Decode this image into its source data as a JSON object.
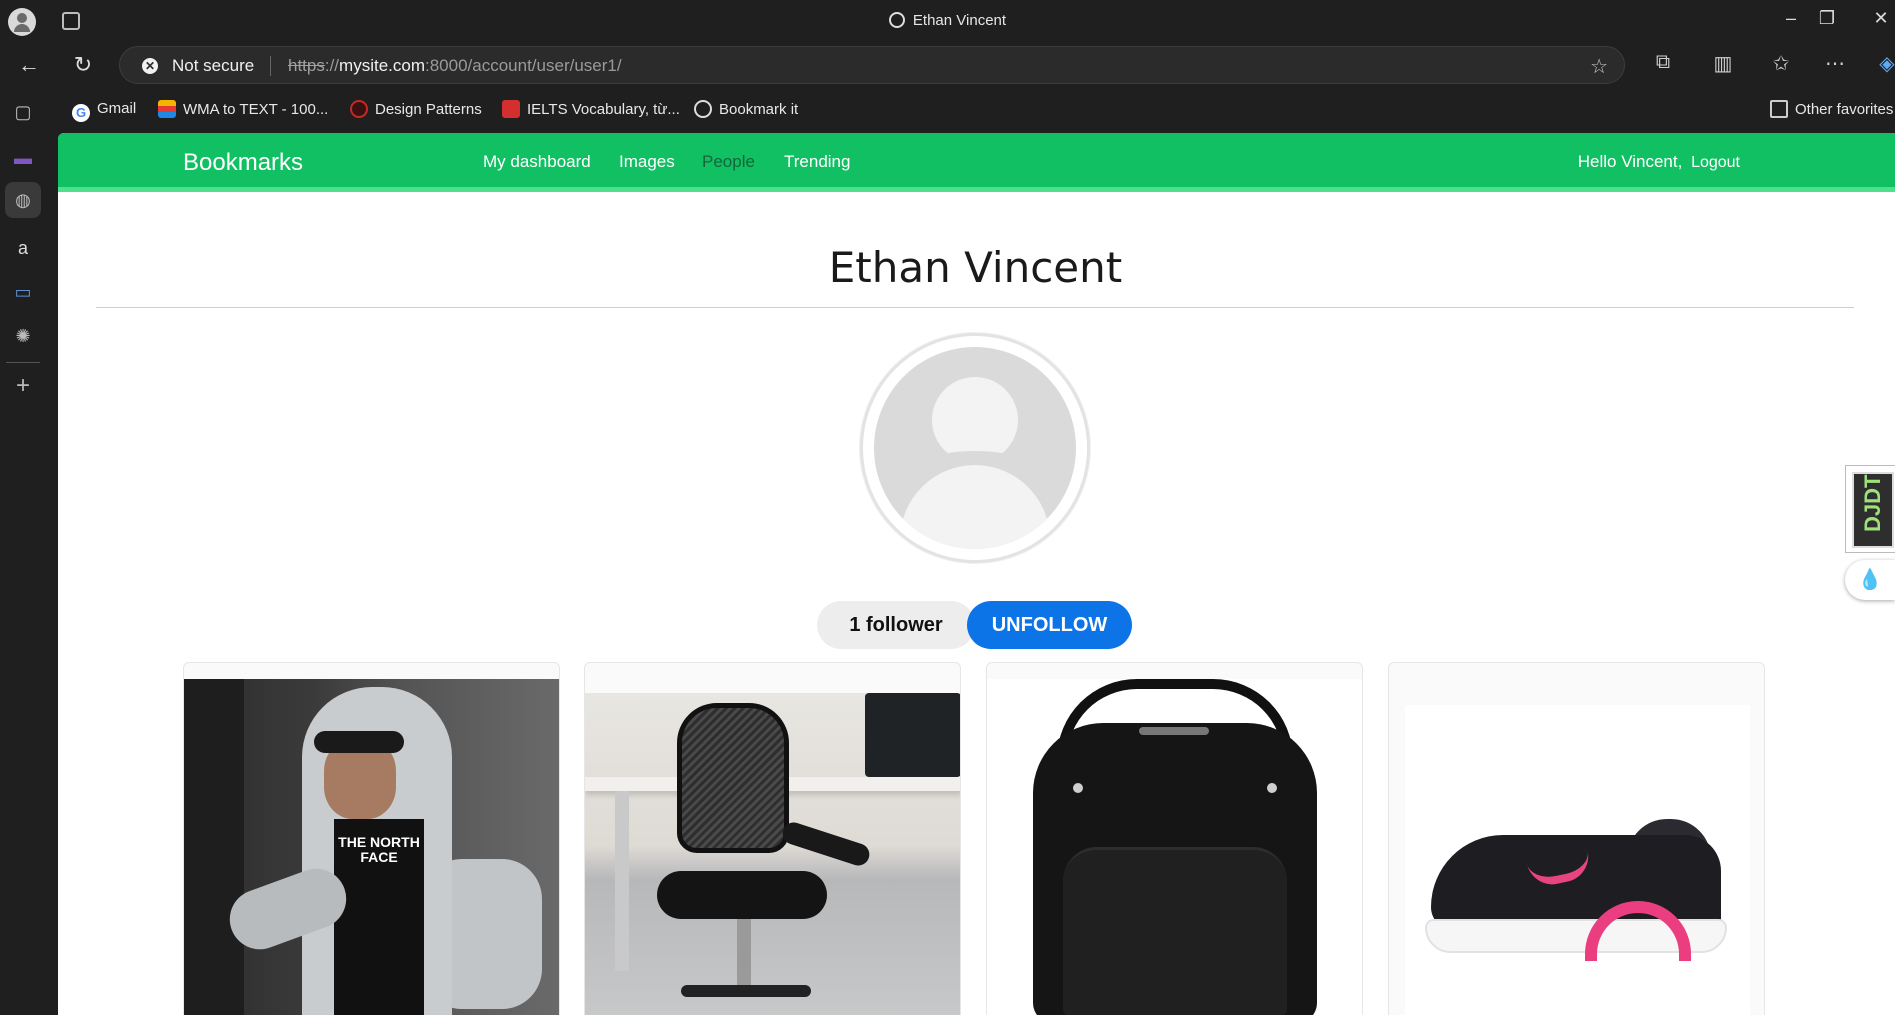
{
  "browser": {
    "window_title": "Ethan Vincent",
    "omnibox": {
      "security_label": "Not secure",
      "url_scheme": "https",
      "url_host": "mysite.com",
      "url_rest": ":8000/account/user/user1/"
    },
    "bookmarks": [
      {
        "label": "Gmail",
        "icon": "google-icon",
        "color": "#4285f4"
      },
      {
        "label": "WMA to TEXT - 100...",
        "icon": "wma-icon",
        "color": "#f4b400"
      },
      {
        "label": "Design Patterns",
        "icon": "design-patterns-icon",
        "color": "#c62828"
      },
      {
        "label": "IELTS Vocabulary, từ...",
        "icon": "ielts-icon",
        "color": "#d32f2f"
      },
      {
        "label": "Bookmark it",
        "icon": "globe-icon",
        "color": "#dddddd"
      }
    ],
    "other_favorites": "Other favorites"
  },
  "site": {
    "brand": "Bookmarks",
    "menu": {
      "dashboard": "My dashboard",
      "images": "Images",
      "people": "People",
      "trending": "Trending"
    },
    "greeting": "Hello Vincent,",
    "logout": "Logout",
    "accent_color": "#12c064"
  },
  "profile": {
    "name": "Ethan Vincent",
    "followers": "1 follower",
    "unfollow": "UNFOLLOW"
  },
  "images": [
    {
      "name": "hoodie-image",
      "depicts": "man in grey hoodie"
    },
    {
      "name": "office-chair-image",
      "depicts": "black mesh office chair"
    },
    {
      "name": "backpack-image",
      "depicts": "black backpack"
    },
    {
      "name": "sneaker-image",
      "depicts": "black and pink sneaker"
    }
  ],
  "shirt_text": "THE NORTH FACE",
  "djdt_label": "DJDT"
}
